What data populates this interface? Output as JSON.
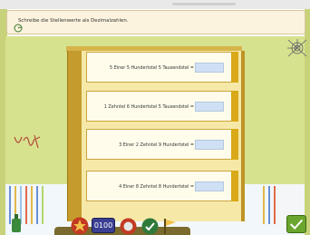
{
  "header": {
    "instruction": "Schreibe die Stellenwerte als Dezimalzahlen."
  },
  "tasks": [
    {
      "prompt": "5 Einer 5 Hundertstel 5 Tausendstel =",
      "answer": ""
    },
    {
      "prompt": "1 Zehntel 6 Hundertstel 5 Tausendstel =",
      "answer": ""
    },
    {
      "prompt": "3 Einer 2 Zehntel 9 Hundertstel =",
      "answer": ""
    },
    {
      "prompt": "4 Einer 8 Zehntel 8 Hundertstel =",
      "answer": ""
    }
  ],
  "toolbar": {
    "counter_label": "0100"
  },
  "icons": {
    "title": "swirl-icon",
    "corner": "spiderweb-icon",
    "wall": "scribble-icon",
    "bottle": "bottle-icon",
    "star": "star-icon",
    "circle": "circle-icon",
    "check": "checkmark-icon",
    "flag": "flag-icon"
  },
  "colors": {
    "wall": "#d7e28e",
    "shelf": "#d6b44a",
    "input": "#cfe0f4",
    "counter": "#3b3f93",
    "confirm": "#6aa52e"
  }
}
